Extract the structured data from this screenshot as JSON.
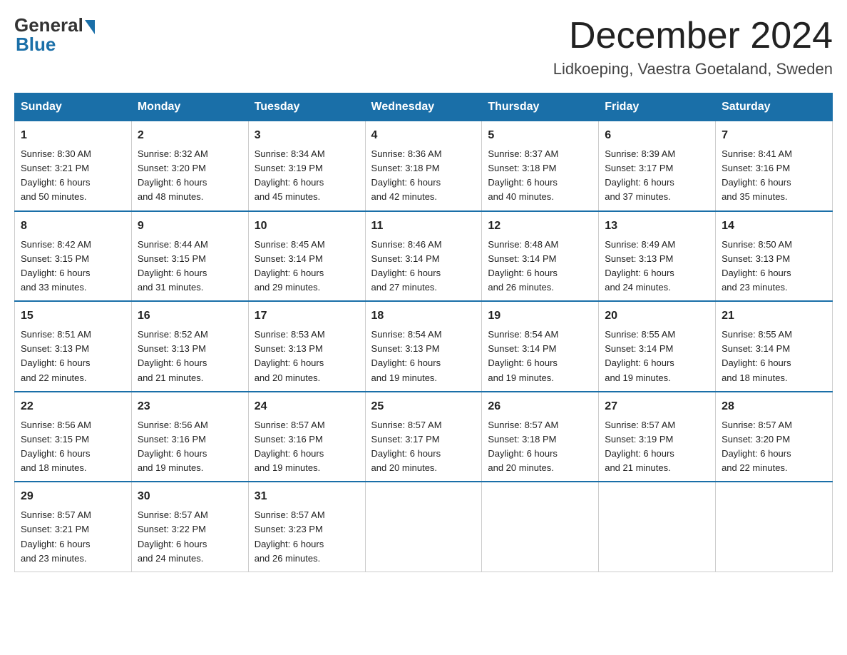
{
  "header": {
    "logo_general": "General",
    "logo_blue": "Blue",
    "month_year": "December 2024",
    "location": "Lidkoeping, Vaestra Goetaland, Sweden"
  },
  "columns": [
    "Sunday",
    "Monday",
    "Tuesday",
    "Wednesday",
    "Thursday",
    "Friday",
    "Saturday"
  ],
  "weeks": [
    [
      {
        "day": "1",
        "sunrise": "8:30 AM",
        "sunset": "3:21 PM",
        "daylight": "6 hours and 50 minutes."
      },
      {
        "day": "2",
        "sunrise": "8:32 AM",
        "sunset": "3:20 PM",
        "daylight": "6 hours and 48 minutes."
      },
      {
        "day": "3",
        "sunrise": "8:34 AM",
        "sunset": "3:19 PM",
        "daylight": "6 hours and 45 minutes."
      },
      {
        "day": "4",
        "sunrise": "8:36 AM",
        "sunset": "3:18 PM",
        "daylight": "6 hours and 42 minutes."
      },
      {
        "day": "5",
        "sunrise": "8:37 AM",
        "sunset": "3:18 PM",
        "daylight": "6 hours and 40 minutes."
      },
      {
        "day": "6",
        "sunrise": "8:39 AM",
        "sunset": "3:17 PM",
        "daylight": "6 hours and 37 minutes."
      },
      {
        "day": "7",
        "sunrise": "8:41 AM",
        "sunset": "3:16 PM",
        "daylight": "6 hours and 35 minutes."
      }
    ],
    [
      {
        "day": "8",
        "sunrise": "8:42 AM",
        "sunset": "3:15 PM",
        "daylight": "6 hours and 33 minutes."
      },
      {
        "day": "9",
        "sunrise": "8:44 AM",
        "sunset": "3:15 PM",
        "daylight": "6 hours and 31 minutes."
      },
      {
        "day": "10",
        "sunrise": "8:45 AM",
        "sunset": "3:14 PM",
        "daylight": "6 hours and 29 minutes."
      },
      {
        "day": "11",
        "sunrise": "8:46 AM",
        "sunset": "3:14 PM",
        "daylight": "6 hours and 27 minutes."
      },
      {
        "day": "12",
        "sunrise": "8:48 AM",
        "sunset": "3:14 PM",
        "daylight": "6 hours and 26 minutes."
      },
      {
        "day": "13",
        "sunrise": "8:49 AM",
        "sunset": "3:13 PM",
        "daylight": "6 hours and 24 minutes."
      },
      {
        "day": "14",
        "sunrise": "8:50 AM",
        "sunset": "3:13 PM",
        "daylight": "6 hours and 23 minutes."
      }
    ],
    [
      {
        "day": "15",
        "sunrise": "8:51 AM",
        "sunset": "3:13 PM",
        "daylight": "6 hours and 22 minutes."
      },
      {
        "day": "16",
        "sunrise": "8:52 AM",
        "sunset": "3:13 PM",
        "daylight": "6 hours and 21 minutes."
      },
      {
        "day": "17",
        "sunrise": "8:53 AM",
        "sunset": "3:13 PM",
        "daylight": "6 hours and 20 minutes."
      },
      {
        "day": "18",
        "sunrise": "8:54 AM",
        "sunset": "3:13 PM",
        "daylight": "6 hours and 19 minutes."
      },
      {
        "day": "19",
        "sunrise": "8:54 AM",
        "sunset": "3:14 PM",
        "daylight": "6 hours and 19 minutes."
      },
      {
        "day": "20",
        "sunrise": "8:55 AM",
        "sunset": "3:14 PM",
        "daylight": "6 hours and 19 minutes."
      },
      {
        "day": "21",
        "sunrise": "8:55 AM",
        "sunset": "3:14 PM",
        "daylight": "6 hours and 18 minutes."
      }
    ],
    [
      {
        "day": "22",
        "sunrise": "8:56 AM",
        "sunset": "3:15 PM",
        "daylight": "6 hours and 18 minutes."
      },
      {
        "day": "23",
        "sunrise": "8:56 AM",
        "sunset": "3:16 PM",
        "daylight": "6 hours and 19 minutes."
      },
      {
        "day": "24",
        "sunrise": "8:57 AM",
        "sunset": "3:16 PM",
        "daylight": "6 hours and 19 minutes."
      },
      {
        "day": "25",
        "sunrise": "8:57 AM",
        "sunset": "3:17 PM",
        "daylight": "6 hours and 20 minutes."
      },
      {
        "day": "26",
        "sunrise": "8:57 AM",
        "sunset": "3:18 PM",
        "daylight": "6 hours and 20 minutes."
      },
      {
        "day": "27",
        "sunrise": "8:57 AM",
        "sunset": "3:19 PM",
        "daylight": "6 hours and 21 minutes."
      },
      {
        "day": "28",
        "sunrise": "8:57 AM",
        "sunset": "3:20 PM",
        "daylight": "6 hours and 22 minutes."
      }
    ],
    [
      {
        "day": "29",
        "sunrise": "8:57 AM",
        "sunset": "3:21 PM",
        "daylight": "6 hours and 23 minutes."
      },
      {
        "day": "30",
        "sunrise": "8:57 AM",
        "sunset": "3:22 PM",
        "daylight": "6 hours and 24 minutes."
      },
      {
        "day": "31",
        "sunrise": "8:57 AM",
        "sunset": "3:23 PM",
        "daylight": "6 hours and 26 minutes."
      },
      {
        "day": "",
        "sunrise": "",
        "sunset": "",
        "daylight": ""
      },
      {
        "day": "",
        "sunrise": "",
        "sunset": "",
        "daylight": ""
      },
      {
        "day": "",
        "sunrise": "",
        "sunset": "",
        "daylight": ""
      },
      {
        "day": "",
        "sunrise": "",
        "sunset": "",
        "daylight": ""
      }
    ]
  ],
  "labels": {
    "sunrise": "Sunrise:",
    "sunset": "Sunset:",
    "daylight": "Daylight:"
  }
}
